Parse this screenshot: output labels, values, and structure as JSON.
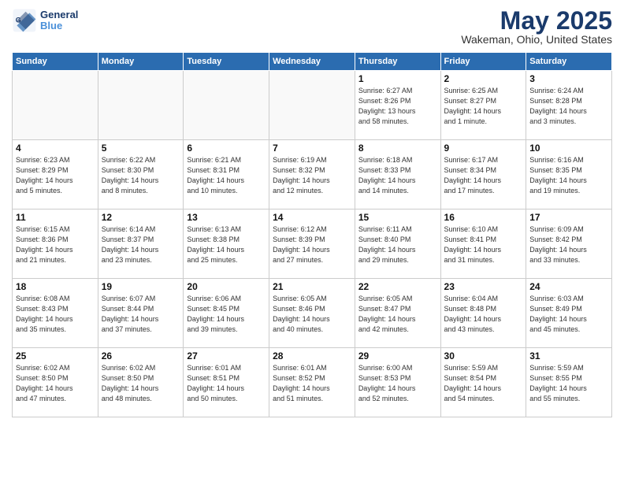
{
  "header": {
    "logo_line1": "General",
    "logo_line2": "Blue",
    "month": "May 2025",
    "location": "Wakeman, Ohio, United States"
  },
  "weekdays": [
    "Sunday",
    "Monday",
    "Tuesday",
    "Wednesday",
    "Thursday",
    "Friday",
    "Saturday"
  ],
  "weeks": [
    [
      {
        "day": "",
        "info": ""
      },
      {
        "day": "",
        "info": ""
      },
      {
        "day": "",
        "info": ""
      },
      {
        "day": "",
        "info": ""
      },
      {
        "day": "1",
        "info": "Sunrise: 6:27 AM\nSunset: 8:26 PM\nDaylight: 13 hours\nand 58 minutes."
      },
      {
        "day": "2",
        "info": "Sunrise: 6:25 AM\nSunset: 8:27 PM\nDaylight: 14 hours\nand 1 minute."
      },
      {
        "day": "3",
        "info": "Sunrise: 6:24 AM\nSunset: 8:28 PM\nDaylight: 14 hours\nand 3 minutes."
      }
    ],
    [
      {
        "day": "4",
        "info": "Sunrise: 6:23 AM\nSunset: 8:29 PM\nDaylight: 14 hours\nand 5 minutes."
      },
      {
        "day": "5",
        "info": "Sunrise: 6:22 AM\nSunset: 8:30 PM\nDaylight: 14 hours\nand 8 minutes."
      },
      {
        "day": "6",
        "info": "Sunrise: 6:21 AM\nSunset: 8:31 PM\nDaylight: 14 hours\nand 10 minutes."
      },
      {
        "day": "7",
        "info": "Sunrise: 6:19 AM\nSunset: 8:32 PM\nDaylight: 14 hours\nand 12 minutes."
      },
      {
        "day": "8",
        "info": "Sunrise: 6:18 AM\nSunset: 8:33 PM\nDaylight: 14 hours\nand 14 minutes."
      },
      {
        "day": "9",
        "info": "Sunrise: 6:17 AM\nSunset: 8:34 PM\nDaylight: 14 hours\nand 17 minutes."
      },
      {
        "day": "10",
        "info": "Sunrise: 6:16 AM\nSunset: 8:35 PM\nDaylight: 14 hours\nand 19 minutes."
      }
    ],
    [
      {
        "day": "11",
        "info": "Sunrise: 6:15 AM\nSunset: 8:36 PM\nDaylight: 14 hours\nand 21 minutes."
      },
      {
        "day": "12",
        "info": "Sunrise: 6:14 AM\nSunset: 8:37 PM\nDaylight: 14 hours\nand 23 minutes."
      },
      {
        "day": "13",
        "info": "Sunrise: 6:13 AM\nSunset: 8:38 PM\nDaylight: 14 hours\nand 25 minutes."
      },
      {
        "day": "14",
        "info": "Sunrise: 6:12 AM\nSunset: 8:39 PM\nDaylight: 14 hours\nand 27 minutes."
      },
      {
        "day": "15",
        "info": "Sunrise: 6:11 AM\nSunset: 8:40 PM\nDaylight: 14 hours\nand 29 minutes."
      },
      {
        "day": "16",
        "info": "Sunrise: 6:10 AM\nSunset: 8:41 PM\nDaylight: 14 hours\nand 31 minutes."
      },
      {
        "day": "17",
        "info": "Sunrise: 6:09 AM\nSunset: 8:42 PM\nDaylight: 14 hours\nand 33 minutes."
      }
    ],
    [
      {
        "day": "18",
        "info": "Sunrise: 6:08 AM\nSunset: 8:43 PM\nDaylight: 14 hours\nand 35 minutes."
      },
      {
        "day": "19",
        "info": "Sunrise: 6:07 AM\nSunset: 8:44 PM\nDaylight: 14 hours\nand 37 minutes."
      },
      {
        "day": "20",
        "info": "Sunrise: 6:06 AM\nSunset: 8:45 PM\nDaylight: 14 hours\nand 39 minutes."
      },
      {
        "day": "21",
        "info": "Sunrise: 6:05 AM\nSunset: 8:46 PM\nDaylight: 14 hours\nand 40 minutes."
      },
      {
        "day": "22",
        "info": "Sunrise: 6:05 AM\nSunset: 8:47 PM\nDaylight: 14 hours\nand 42 minutes."
      },
      {
        "day": "23",
        "info": "Sunrise: 6:04 AM\nSunset: 8:48 PM\nDaylight: 14 hours\nand 43 minutes."
      },
      {
        "day": "24",
        "info": "Sunrise: 6:03 AM\nSunset: 8:49 PM\nDaylight: 14 hours\nand 45 minutes."
      }
    ],
    [
      {
        "day": "25",
        "info": "Sunrise: 6:02 AM\nSunset: 8:50 PM\nDaylight: 14 hours\nand 47 minutes."
      },
      {
        "day": "26",
        "info": "Sunrise: 6:02 AM\nSunset: 8:50 PM\nDaylight: 14 hours\nand 48 minutes."
      },
      {
        "day": "27",
        "info": "Sunrise: 6:01 AM\nSunset: 8:51 PM\nDaylight: 14 hours\nand 50 minutes."
      },
      {
        "day": "28",
        "info": "Sunrise: 6:01 AM\nSunset: 8:52 PM\nDaylight: 14 hours\nand 51 minutes."
      },
      {
        "day": "29",
        "info": "Sunrise: 6:00 AM\nSunset: 8:53 PM\nDaylight: 14 hours\nand 52 minutes."
      },
      {
        "day": "30",
        "info": "Sunrise: 5:59 AM\nSunset: 8:54 PM\nDaylight: 14 hours\nand 54 minutes."
      },
      {
        "day": "31",
        "info": "Sunrise: 5:59 AM\nSunset: 8:55 PM\nDaylight: 14 hours\nand 55 minutes."
      }
    ]
  ]
}
